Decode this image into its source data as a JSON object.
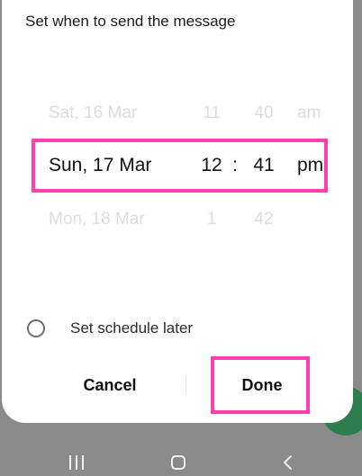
{
  "dialog": {
    "title": "Set when to send the message"
  },
  "picker": {
    "previous": {
      "date": "Sat, 16 Mar",
      "hour": "11",
      "minute": "40",
      "ampm": "am"
    },
    "selected": {
      "date": "Sun, 17 Mar",
      "hour": "12",
      "separator": ":",
      "minute": "41",
      "ampm": "pm"
    },
    "next": {
      "date": "Mon, 18 Mar",
      "hour": "1",
      "minute": "42"
    }
  },
  "options": {
    "schedule_later_label": "Set schedule later"
  },
  "buttons": {
    "cancel_label": "Cancel",
    "done_label": "Done"
  },
  "colors": {
    "highlight": "#ff3fb1",
    "fab": "#2e7d4f"
  },
  "navbar": {
    "icons": [
      "recents-icon",
      "home-icon",
      "back-icon"
    ]
  }
}
